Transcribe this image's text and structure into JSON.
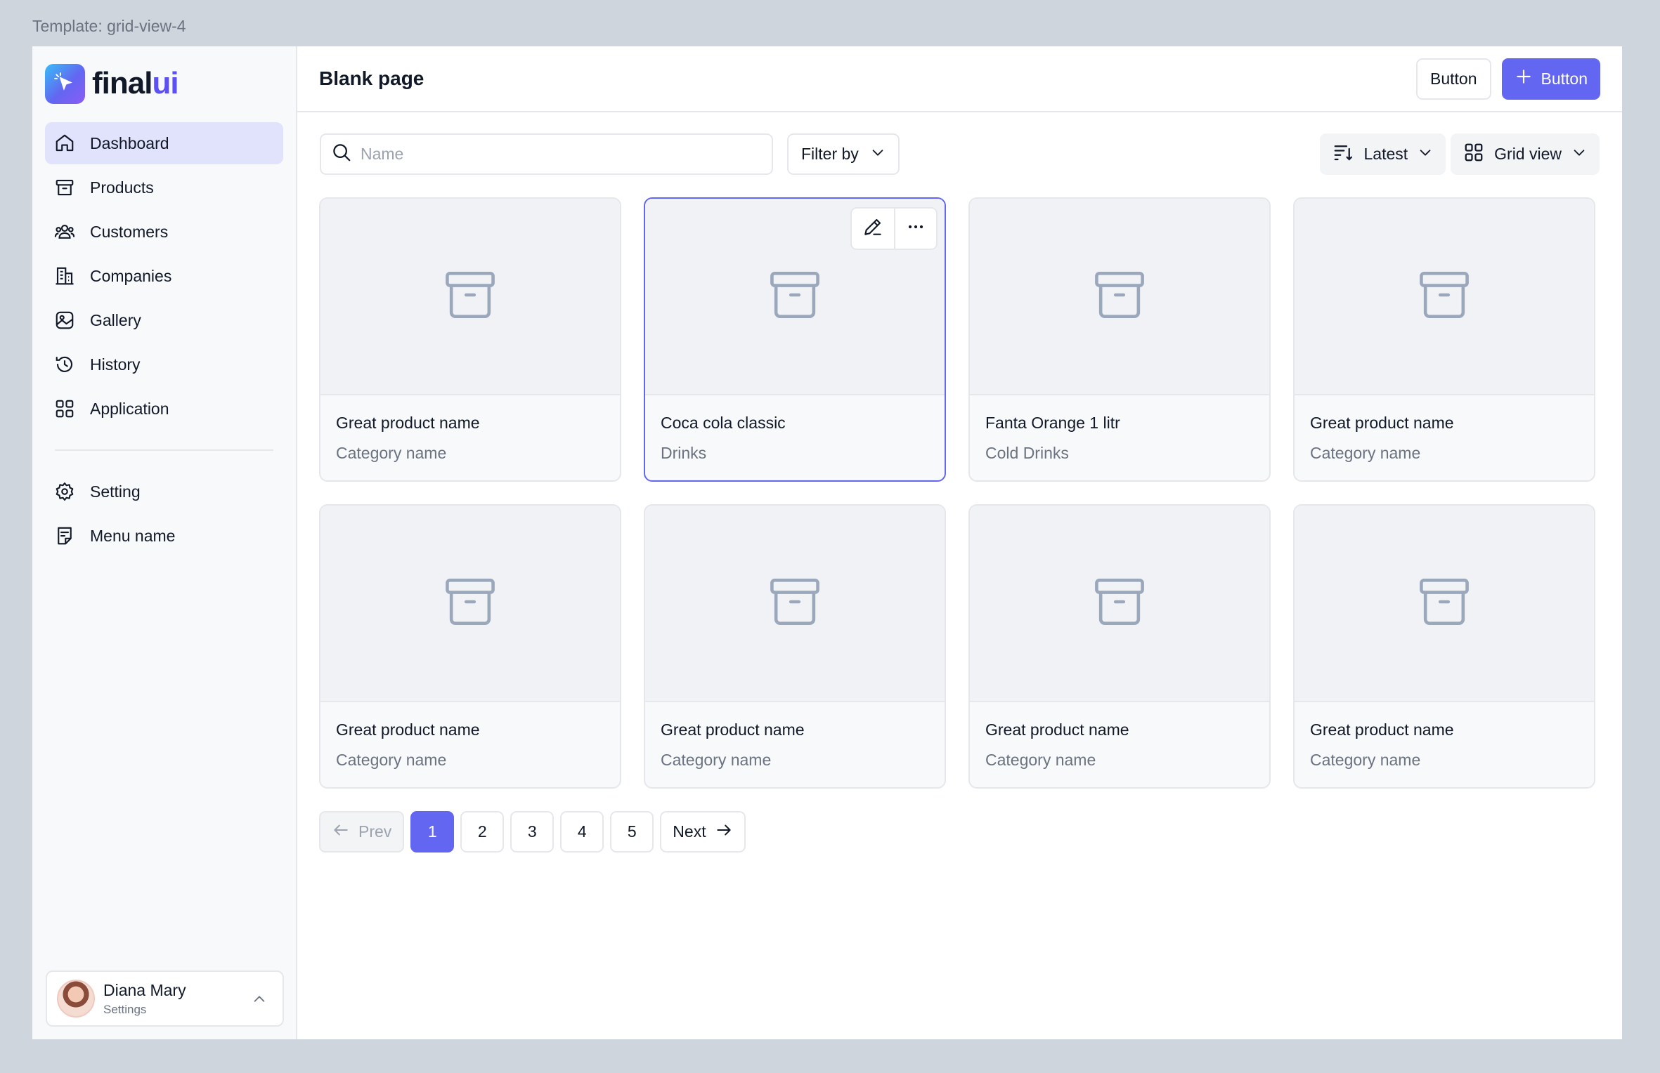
{
  "template_label": "Template: grid-view-4",
  "brand": {
    "name_main": "final",
    "name_accent": "ui",
    "accent_color": "#5B4FF5"
  },
  "sidebar": {
    "items": [
      {
        "label": "Dashboard",
        "icon": "home-icon",
        "active": true
      },
      {
        "label": "Products",
        "icon": "archive-icon"
      },
      {
        "label": "Customers",
        "icon": "users-icon"
      },
      {
        "label": "Companies",
        "icon": "building-icon"
      },
      {
        "label": "Gallery",
        "icon": "image-icon"
      },
      {
        "label": "History",
        "icon": "clock-icon"
      },
      {
        "label": "Application",
        "icon": "grid-icon"
      }
    ],
    "secondary": [
      {
        "label": "Setting",
        "icon": "gear-icon"
      },
      {
        "label": "Menu name",
        "icon": "note-icon"
      }
    ]
  },
  "profile": {
    "name": "Diana Mary",
    "sub": "Settings"
  },
  "header": {
    "title": "Blank page",
    "button_outline": "Button",
    "button_primary": "Button"
  },
  "toolbar": {
    "search_placeholder": "Name",
    "filter_label": "Filter by",
    "sort_label": "Latest",
    "view_label": "Grid view"
  },
  "cards": [
    {
      "name": "Great product name",
      "category": "Category name"
    },
    {
      "name": "Coca cola classic",
      "category": "Drinks",
      "selected": true
    },
    {
      "name": "Fanta Orange 1 litr",
      "category": "Cold Drinks"
    },
    {
      "name": "Great product name",
      "category": "Category name"
    },
    {
      "name": "Great product name",
      "category": "Category name"
    },
    {
      "name": "Great product name",
      "category": "Category name"
    },
    {
      "name": "Great product name",
      "category": "Category name"
    },
    {
      "name": "Great product name",
      "category": "Category name"
    }
  ],
  "pagination": {
    "prev": "Prev",
    "pages": [
      "1",
      "2",
      "3",
      "4",
      "5"
    ],
    "current": "1",
    "next": "Next"
  },
  "colors": {
    "primary": "#6366F1",
    "active_nav": "#E0E3FB"
  }
}
